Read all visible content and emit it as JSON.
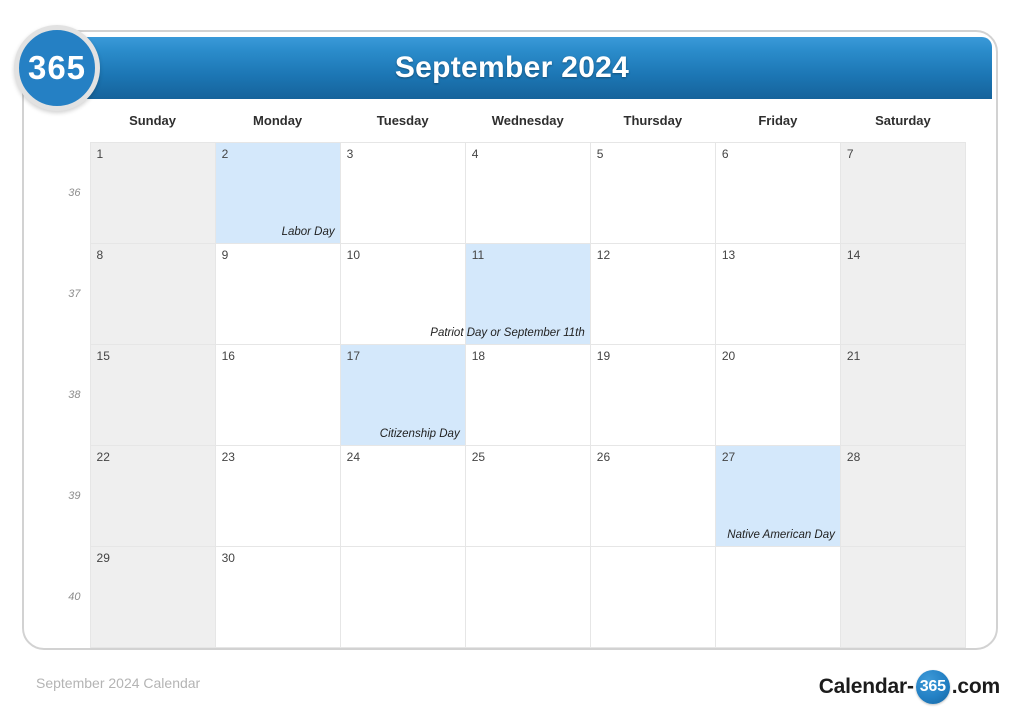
{
  "badge": {
    "label": "365"
  },
  "header": {
    "title": "September 2024"
  },
  "watermark": {
    "text": "365"
  },
  "weekdays": [
    "Sunday",
    "Monday",
    "Tuesday",
    "Wednesday",
    "Thursday",
    "Friday",
    "Saturday"
  ],
  "weeks": [
    {
      "week_number": "36",
      "days": [
        {
          "num": "1",
          "weekend": true,
          "holiday": ""
        },
        {
          "num": "2",
          "weekend": false,
          "holiday": "Labor Day"
        },
        {
          "num": "3",
          "weekend": false,
          "holiday": ""
        },
        {
          "num": "4",
          "weekend": false,
          "holiday": ""
        },
        {
          "num": "5",
          "weekend": false,
          "holiday": ""
        },
        {
          "num": "6",
          "weekend": false,
          "holiday": ""
        },
        {
          "num": "7",
          "weekend": true,
          "holiday": ""
        }
      ]
    },
    {
      "week_number": "37",
      "days": [
        {
          "num": "8",
          "weekend": true,
          "holiday": ""
        },
        {
          "num": "9",
          "weekend": false,
          "holiday": ""
        },
        {
          "num": "10",
          "weekend": false,
          "holiday": ""
        },
        {
          "num": "11",
          "weekend": false,
          "holiday": "Patriot Day or September 11th"
        },
        {
          "num": "12",
          "weekend": false,
          "holiday": ""
        },
        {
          "num": "13",
          "weekend": false,
          "holiday": ""
        },
        {
          "num": "14",
          "weekend": true,
          "holiday": ""
        }
      ]
    },
    {
      "week_number": "38",
      "days": [
        {
          "num": "15",
          "weekend": true,
          "holiday": ""
        },
        {
          "num": "16",
          "weekend": false,
          "holiday": ""
        },
        {
          "num": "17",
          "weekend": false,
          "holiday": "Citizenship Day"
        },
        {
          "num": "18",
          "weekend": false,
          "holiday": ""
        },
        {
          "num": "19",
          "weekend": false,
          "holiday": ""
        },
        {
          "num": "20",
          "weekend": false,
          "holiday": ""
        },
        {
          "num": "21",
          "weekend": true,
          "holiday": ""
        }
      ]
    },
    {
      "week_number": "39",
      "days": [
        {
          "num": "22",
          "weekend": true,
          "holiday": ""
        },
        {
          "num": "23",
          "weekend": false,
          "holiday": ""
        },
        {
          "num": "24",
          "weekend": false,
          "holiday": ""
        },
        {
          "num": "25",
          "weekend": false,
          "holiday": ""
        },
        {
          "num": "26",
          "weekend": false,
          "holiday": ""
        },
        {
          "num": "27",
          "weekend": false,
          "holiday": "Native American Day"
        },
        {
          "num": "28",
          "weekend": true,
          "holiday": ""
        }
      ]
    },
    {
      "week_number": "40",
      "days": [
        {
          "num": "29",
          "weekend": true,
          "holiday": ""
        },
        {
          "num": "30",
          "weekend": false,
          "holiday": ""
        },
        {
          "num": "",
          "weekend": false,
          "holiday": ""
        },
        {
          "num": "",
          "weekend": false,
          "holiday": ""
        },
        {
          "num": "",
          "weekend": false,
          "holiday": ""
        },
        {
          "num": "",
          "weekend": false,
          "holiday": ""
        },
        {
          "num": "",
          "weekend": true,
          "holiday": ""
        }
      ]
    }
  ],
  "footer": {
    "caption": "September 2024 Calendar",
    "brand_prefix": "Calendar-",
    "brand_circle": "365",
    "brand_suffix": ".com"
  },
  "colors": {
    "header_blue": "#1c76b4",
    "holiday_blue": "#d4e8fb",
    "weekend_gray": "#efefef",
    "badge_blue": "#2580c4"
  }
}
